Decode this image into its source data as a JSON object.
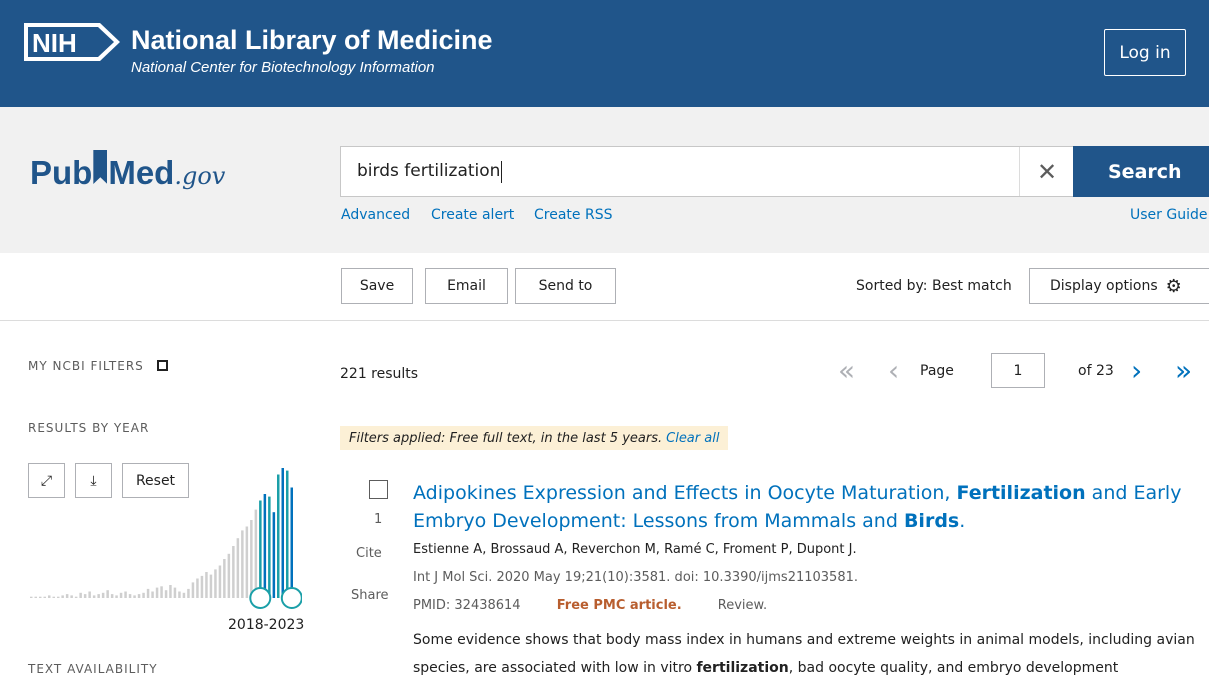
{
  "header": {
    "logo_text": "NIH",
    "title": "National Library of Medicine",
    "subtitle": "National Center for Biotechnology Information",
    "login_label": "Log in",
    "bg_color": "#20558a"
  },
  "search": {
    "logo_pub": "Pub",
    "logo_med": "Med",
    "logo_gov": ".gov",
    "query": "birds fertilization",
    "search_label": "Search",
    "links": [
      "Advanced",
      "Create alert",
      "Create RSS"
    ],
    "user_guide": "User Guide"
  },
  "toolbar": {
    "save": "Save",
    "email": "Email",
    "send_to": "Send to",
    "sorted_by": "Sorted by: Best match",
    "display_options": "Display options"
  },
  "sidebar": {
    "my_ncbi_filters": "MY NCBI FILTERS",
    "results_by_year": "RESULTS BY YEAR",
    "reset": "Reset",
    "year_range": "2018-2023",
    "text_availability": "TEXT AVAILABILITY"
  },
  "results": {
    "count": "221 results",
    "page_label": "Page",
    "page_value": "1",
    "page_of": "of 23",
    "filters_text": "Filters applied: Free full text, in the last 5 years.",
    "clear_all": "Clear all",
    "item": {
      "number": "1",
      "cite": "Cite",
      "share": "Share",
      "title_parts": [
        "Adipokines Expression and Effects in Oocyte Maturation, ",
        "Fertilization",
        " and Early Embryo Development: Lessons from Mammals and ",
        "Birds",
        "."
      ],
      "authors": "Estienne A, Brossaud A, Reverchon M, Ramé C, Froment P, Dupont J.",
      "citation": "Int J Mol Sci. 2020 May 19;21(10):3581. doi: 10.3390/ijms21103581.",
      "pmid": "PMID: 32438614",
      "free_pmc": "Free PMC article.",
      "review": "Review.",
      "snippet_parts": [
        "Some evidence shows that body mass index in humans and extreme weights in animal models, including avian species, are associated with low in vitro ",
        "fertilization",
        ", bad oocyte quality, and embryo development"
      ]
    }
  },
  "histogram": {
    "bars": [
      1,
      1,
      1,
      1,
      2,
      1,
      1,
      2,
      3,
      2,
      1,
      4,
      3,
      5,
      2,
      3,
      4,
      6,
      3,
      2,
      4,
      5,
      3,
      2,
      3,
      4,
      7,
      5,
      8,
      9,
      6,
      10,
      8,
      5,
      4,
      7,
      12,
      15,
      17,
      20,
      18,
      22,
      25,
      30,
      34,
      40,
      46,
      52,
      55,
      60,
      68,
      75,
      80,
      78,
      66,
      95,
      100,
      98,
      85
    ],
    "selected_from_index": 51,
    "accent": "#0071bc",
    "selected_color": "#1a9fa8",
    "unselected_color": "#cfcfcf"
  }
}
